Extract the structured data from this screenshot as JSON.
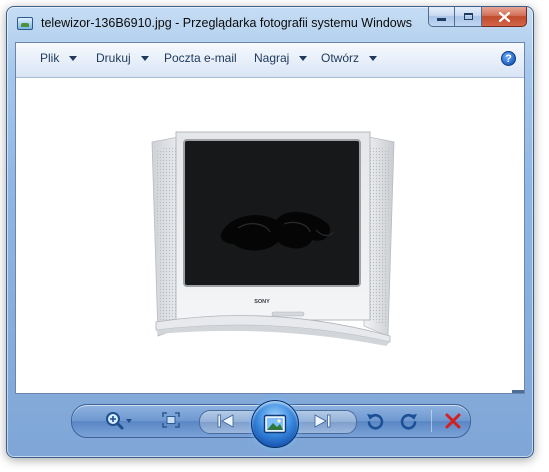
{
  "window": {
    "title": "telewizor-136B6910.jpg - Przeglądarka fotografii systemu Windows"
  },
  "caption_buttons": {
    "minimize": "minimize",
    "maximize": "maximize",
    "close": "close"
  },
  "menu": {
    "items": [
      {
        "label": "Plik",
        "has_dropdown": true
      },
      {
        "label": "Drukuj",
        "has_dropdown": true
      },
      {
        "label": "Poczta e-mail",
        "has_dropdown": false
      },
      {
        "label": "Nagraj",
        "has_dropdown": true
      },
      {
        "label": "Otwórz",
        "has_dropdown": true
      }
    ],
    "help_glyph": "?"
  },
  "image": {
    "subject": "telewizor",
    "brand_mark": "SONY"
  },
  "controls": {
    "icons": [
      "zoom-icon",
      "fit-to-window-icon",
      "previous-icon",
      "slideshow-icon",
      "next-icon",
      "rotate-counterclockwise-icon",
      "rotate-clockwise-icon",
      "delete-icon"
    ]
  },
  "colors": {
    "frame_accent": "#7fa6d6",
    "close_button": "#c04a2c",
    "delete_icon": "#d62020",
    "slideshow_glow": "#3b8be0"
  }
}
